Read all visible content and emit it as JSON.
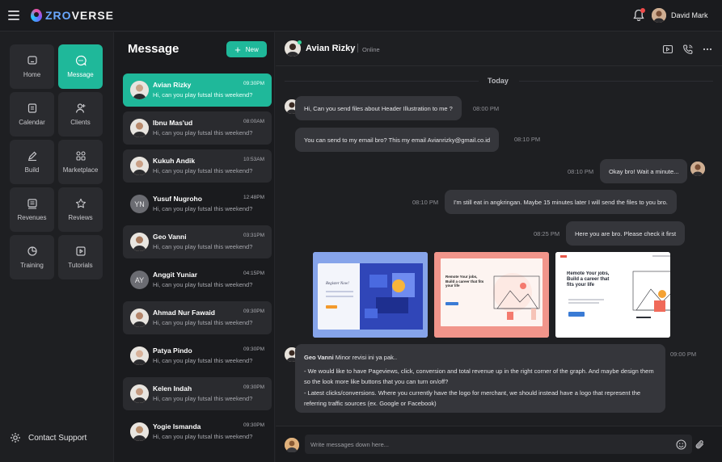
{
  "app": {
    "brand_prefix": "ZRO",
    "brand_suffix": "VERSE"
  },
  "user": {
    "name": "David Mark"
  },
  "nav": [
    {
      "label": "Home",
      "icon": "home-icon"
    },
    {
      "label": "Message",
      "icon": "message-icon",
      "active": true
    },
    {
      "label": "Calendar",
      "icon": "calendar-icon"
    },
    {
      "label": "Clients",
      "icon": "clients-icon"
    },
    {
      "label": "Build",
      "icon": "build-icon"
    },
    {
      "label": "Marketplace",
      "icon": "marketplace-icon"
    },
    {
      "label": "Revenues",
      "icon": "revenues-icon"
    },
    {
      "label": "Reviews",
      "icon": "star-icon"
    },
    {
      "label": "Training",
      "icon": "training-icon"
    },
    {
      "label": "Tutorials",
      "icon": "tutorials-icon"
    }
  ],
  "support": {
    "label": "Contact Support"
  },
  "messages": {
    "title": "Message",
    "new_label": "New",
    "conversations": [
      {
        "name": "Avian Rizky",
        "time": "09:30PM",
        "preview": "Hi, can you play futsal this weekend?",
        "active": true
      },
      {
        "name": "Ibnu Mas'ud",
        "time": "08:00AM",
        "preview": "Hi, can you play futsal this weekend?"
      },
      {
        "name": "Kukuh Andik",
        "time": "10:53AM",
        "preview": "Hi, can you play futsal this weekend?"
      },
      {
        "name": "Yusuf Nugroho",
        "time": "12:48PM",
        "preview": "Hi, can you play futsal this weekend?",
        "initials": "YN"
      },
      {
        "name": "Geo Vanni",
        "time": "03:31PM",
        "preview": "Hi, can you play futsal this weekend?"
      },
      {
        "name": "Anggit Yuniar",
        "time": "04:15PM",
        "preview": "Hi, can you play futsal this weekend?",
        "initials": "AY"
      },
      {
        "name": "Ahmad Nur Fawaid",
        "time": "09:30PM",
        "preview": "Hi, can you play futsal this weekend?"
      },
      {
        "name": "Patya Pindo",
        "time": "09:30PM",
        "preview": "Hi, can you play futsal this weekend?"
      },
      {
        "name": "Kelen Indah",
        "time": "09:30PM",
        "preview": "Hi, can you play futsal this weekend?"
      },
      {
        "name": "Yogie Ismanda",
        "time": "09:30PM",
        "preview": "Hi, can you play futsal this weekend?"
      }
    ]
  },
  "chat": {
    "contact_name": "Avian Rizky",
    "status": "Online",
    "day_label": "Today",
    "msgs": [
      {
        "text": "Hi, Can you send files about Header Illustration to me ?",
        "time": "08:00 PM"
      },
      {
        "text": "You can send to my email bro? This my email Avianrizky@gmail.co.id",
        "time": "08:10 PM"
      },
      {
        "text": "Okay bro! Wait a minute...",
        "time": "08:10 PM"
      },
      {
        "text": "I'm still eat in angkringan. Maybe 15 minutes later I will send the files to you bro.",
        "time": "08:10 PM"
      },
      {
        "text": "Here you are bro. Please check it first",
        "time": "08:25 PM"
      }
    ],
    "attachments": [
      {
        "heading": "Register Now!"
      },
      {
        "heading": "Remote Your jobs, Build a career that fits your life"
      },
      {
        "heading": "Remote Your jobs, Build a career that fits your life"
      }
    ],
    "long_msg": {
      "author": "Geo Vanni",
      "intro": "Minor revisi ini ya pak..",
      "line1": "- We would like to have Pageviews, click, conversion and total revenue up in the right corner of the graph. And maybe design them so the look more like buttons that you can turn on/off?",
      "line2": "- Latest clicks/conversions. Where you currently have the logo for merchant, we should instead have a logo that represent the referring traffic sources (ex. Google or Facebook)",
      "time": "09:00 PM"
    },
    "composer_placeholder": "Write messages down here..."
  },
  "colors": {
    "accent": "#1fb89a",
    "bubble": "#35363b",
    "background": "#1e1f22"
  }
}
